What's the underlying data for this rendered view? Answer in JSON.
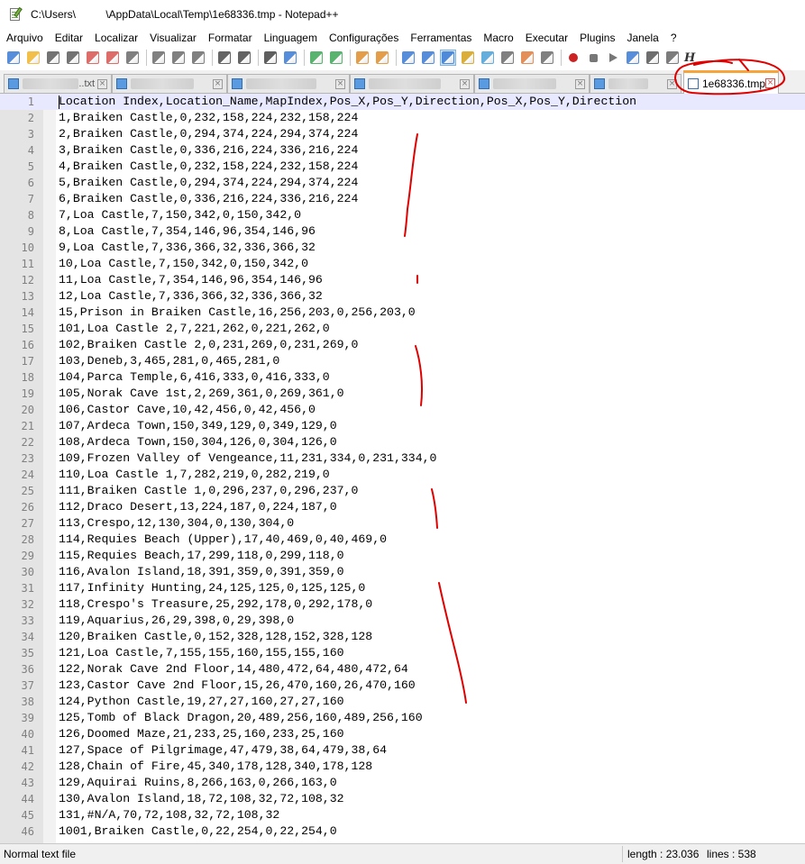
{
  "window": {
    "title": "C:\\Users\\          \\AppData\\Local\\Temp\\1e68336.tmp - Notepad++"
  },
  "menu": [
    "Arquivo",
    "Editar",
    "Localizar",
    "Visualizar",
    "Formatar",
    "Linguagem",
    "Configurações",
    "Ferramentas",
    "Macro",
    "Executar",
    "Plugins",
    "Janela",
    "?"
  ],
  "toolbar": {
    "icons": [
      "new-file-icon",
      "open-file-icon",
      "save-icon",
      "save-all-icon",
      "close-icon",
      "close-all-icon",
      "print-icon",
      "cut-icon",
      "copy-icon",
      "paste-icon",
      "undo-icon",
      "redo-icon",
      "find-icon",
      "replace-icon",
      "zoom-in-icon",
      "zoom-out-icon",
      "sync-vertical-icon",
      "sync-horizontal-icon",
      "word-wrap-icon",
      "show-all-chars-icon",
      "indent-guide-icon",
      "udl-icon",
      "doc-map-icon",
      "function-list-icon",
      "folder-workspace-icon",
      "monitor-icon",
      "record-macro-icon",
      "stop-record-icon",
      "play-macro-icon",
      "run-macro-multiple-icon",
      "save-macro-icon",
      "spell-check-icon"
    ],
    "extra_label": "H"
  },
  "tabs": [
    {
      "label": "...table_eval...txt",
      "active": false
    },
    {
      "label": "...txt",
      "active": false
    },
    {
      "label": "...txt",
      "active": false
    },
    {
      "label": "...txt",
      "active": false
    },
    {
      "label": "...txt",
      "active": false
    },
    {
      "label": "...txt",
      "active": false
    },
    {
      "label": "1e68336.tmp",
      "active": true
    }
  ],
  "editor": {
    "current_line": 1,
    "lines": [
      "Location Index,Location_Name,MapIndex,Pos_X,Pos_Y,Direction,Pos_X,Pos_Y,Direction",
      "1,Braiken Castle,0,232,158,224,232,158,224",
      "2,Braiken Castle,0,294,374,224,294,374,224",
      "3,Braiken Castle,0,336,216,224,336,216,224",
      "4,Braiken Castle,0,232,158,224,232,158,224",
      "5,Braiken Castle,0,294,374,224,294,374,224",
      "6,Braiken Castle,0,336,216,224,336,216,224",
      "7,Loa Castle,7,150,342,0,150,342,0",
      "8,Loa Castle,7,354,146,96,354,146,96",
      "9,Loa Castle,7,336,366,32,336,366,32",
      "10,Loa Castle,7,150,342,0,150,342,0",
      "11,Loa Castle,7,354,146,96,354,146,96",
      "12,Loa Castle,7,336,366,32,336,366,32",
      "15,Prison in Braiken Castle,16,256,203,0,256,203,0",
      "101,Loa Castle 2,7,221,262,0,221,262,0",
      "102,Braiken Castle 2,0,231,269,0,231,269,0",
      "103,Deneb,3,465,281,0,465,281,0",
      "104,Parca Temple,6,416,333,0,416,333,0",
      "105,Norak Cave 1st,2,269,361,0,269,361,0",
      "106,Castor Cave,10,42,456,0,42,456,0",
      "107,Ardeca Town,150,349,129,0,349,129,0",
      "108,Ardeca Town,150,304,126,0,304,126,0",
      "109,Frozen Valley of Vengeance,11,231,334,0,231,334,0",
      "110,Loa Castle 1,7,282,219,0,282,219,0",
      "111,Braiken Castle 1,0,296,237,0,296,237,0",
      "112,Draco Desert,13,224,187,0,224,187,0",
      "113,Crespo,12,130,304,0,130,304,0",
      "114,Requies Beach (Upper),17,40,469,0,40,469,0",
      "115,Requies Beach,17,299,118,0,299,118,0",
      "116,Avalon Island,18,391,359,0,391,359,0",
      "117,Infinity Hunting,24,125,125,0,125,125,0",
      "118,Crespo's Treasure,25,292,178,0,292,178,0",
      "119,Aquarius,26,29,398,0,29,398,0",
      "120,Braiken Castle,0,152,328,128,152,328,128",
      "121,Loa Castle,7,155,155,160,155,155,160",
      "122,Norak Cave 2nd Floor,14,480,472,64,480,472,64",
      "123,Castor Cave 2nd Floor,15,26,470,160,26,470,160",
      "124,Python Castle,19,27,27,160,27,27,160",
      "125,Tomb of Black Dragon,20,489,256,160,489,256,160",
      "126,Doomed Maze,21,233,25,160,233,25,160",
      "127,Space of Pilgrimage,47,479,38,64,479,38,64",
      "128,Chain of Fire,45,340,178,128,340,178,128",
      "129,Aquirai Ruins,8,266,163,0,266,163,0",
      "130,Avalon Island,18,72,108,32,72,108,32",
      "131,#N/A,70,72,108,32,72,108,32",
      "1001,Braiken Castle,0,22,254,0,22,254,0"
    ]
  },
  "status": {
    "file_type": "Normal text file",
    "length": "length : 23.036",
    "lines": "lines : 538"
  },
  "colors": {
    "tab_active_accent": "#f7a43a",
    "annotation": "#e00000",
    "gutter": "#e4e4e4"
  }
}
